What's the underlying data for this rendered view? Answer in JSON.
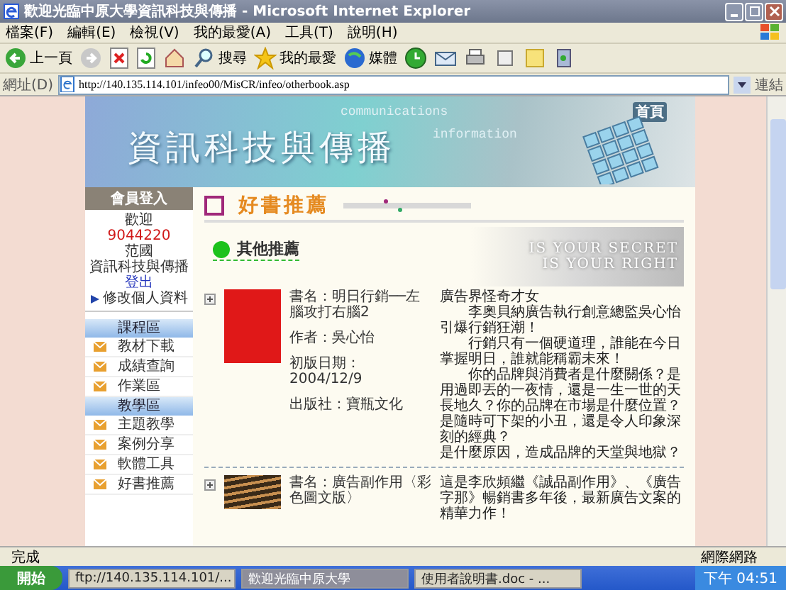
{
  "window": {
    "title": "歡迎光臨中原大學資訊科技與傳播 - Microsoft Internet Explorer"
  },
  "menu": [
    "檔案(F)",
    "編輯(E)",
    "檢視(V)",
    "我的最愛(A)",
    "工具(T)",
    "說明(H)"
  ],
  "toolbar": [
    {
      "kind": "back",
      "label": "上一頁"
    },
    {
      "kind": "forward"
    },
    {
      "kind": "stop"
    },
    {
      "kind": "refresh"
    },
    {
      "kind": "home"
    },
    {
      "kind": "search",
      "label": "搜尋"
    },
    {
      "kind": "favorites",
      "label": "我的最愛"
    },
    {
      "kind": "media",
      "label": "媒體"
    },
    {
      "kind": "history"
    },
    {
      "kind": "mail"
    },
    {
      "kind": "print"
    },
    {
      "kind": "edit"
    },
    {
      "kind": "note"
    },
    {
      "kind": "messenger"
    }
  ],
  "address": {
    "label": "網址(D)",
    "value": "http://140.135.114.101/infeo00/MisCR/infeo/otherbook.asp",
    "links": "連結"
  },
  "banner": {
    "title": "資訊科技與傳播",
    "home": "首頁",
    "words": [
      "communications",
      "information"
    ]
  },
  "member": {
    "title": "會員登入",
    "lines": [
      {
        "kind": "text",
        "text": "歡迎"
      },
      {
        "kind": "id",
        "text": "9044220"
      },
      {
        "kind": "text",
        "text": "范國"
      },
      {
        "kind": "text",
        "text": "資訊科技與傳播"
      },
      {
        "kind": "link",
        "text": "登出"
      },
      {
        "kind": "arrow",
        "text": "修改個人資料"
      }
    ]
  },
  "nav": [
    {
      "title": "課程區",
      "items": [
        "教材下載",
        "成績查詢",
        "作業區"
      ]
    },
    {
      "title": "教學區",
      "items": [
        "主題教學",
        "案例分享",
        "軟體工具",
        "好書推薦"
      ]
    }
  ],
  "heading": "好書推薦",
  "subheading": "其他推薦",
  "slogan": [
    "IS YOUR SECRET",
    "IS YOUR RIGHT"
  ],
  "books": [
    {
      "kind": "red",
      "fields": [
        "書名：明日行銷──左腦攻打右腦2",
        "作者：吳心怡",
        "初版日期：2004/12/9",
        "出版社：寶瓶文化"
      ],
      "description": [
        "廣告界怪奇才女",
        "　　李奧貝納廣告執行創意總監吳心怡引爆行銷狂潮！",
        "　　行銷只有一個硬道理，誰能在今日掌握明日，誰就能稱霸未來！",
        "　　你的品牌與消費者是什麼關係？是用過即丟的一夜情，還是一生一世的天長地久？你的品牌在市場是什麼位置？是隨時可下架的小丑，還是令人印象深刻的經典？",
        "是什麼原因，造成品牌的天堂與地獄？"
      ]
    },
    {
      "kind": "photo",
      "fields": [
        "書名：廣告副作用〈彩色圖文版〉"
      ],
      "description": [
        "這是李欣頻繼《誠品副作用》、《廣告字那》暢銷書多年後，最新廣告文案的精華力作！"
      ]
    }
  ],
  "status": {
    "text": "完成",
    "zone": "網際網路"
  },
  "taskbar": {
    "start": "開始",
    "tasks": [
      {
        "label": "ftp://140.135.114.101/...",
        "selected": false
      },
      {
        "label": "歡迎光臨中原大學",
        "selected": true
      },
      {
        "label": "使用者說明書.doc - ...",
        "selected": false
      }
    ],
    "clock": "下午 04:51"
  }
}
